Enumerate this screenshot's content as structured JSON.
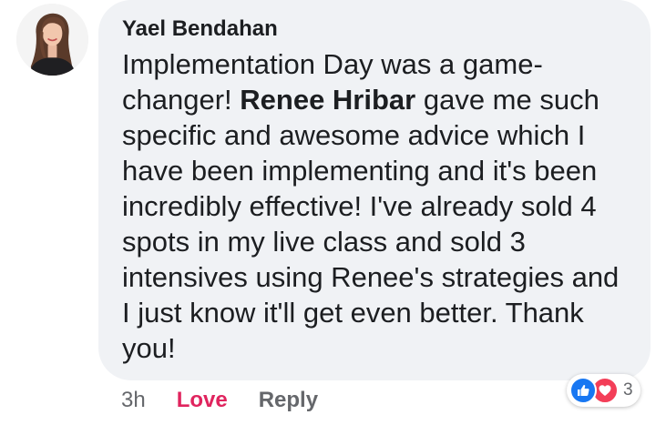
{
  "comment": {
    "author": "Yael Bendahan",
    "text_before": "Implementation Day was a game-changer! ",
    "mention": "Renee Hribar",
    "text_after": " gave me such specific and awesome advice which I have been implementing and it's been incredibly effective! I've already sold 4 spots in my live class and sold 3 intensives using Renee's strategies and I just know it'll get even better. Thank you!"
  },
  "actions": {
    "timestamp": "3h",
    "love_label": "Love",
    "reply_label": "Reply"
  },
  "reactions": {
    "icons": [
      "like-icon",
      "love-icon"
    ],
    "count": "3"
  },
  "colors": {
    "bubble_background": "#f0f2f5",
    "text": "#1c1e21",
    "secondary_text": "#65676b",
    "love_accent": "#e0245e",
    "like_blue": "#1877f2",
    "love_red": "#f33e58"
  }
}
